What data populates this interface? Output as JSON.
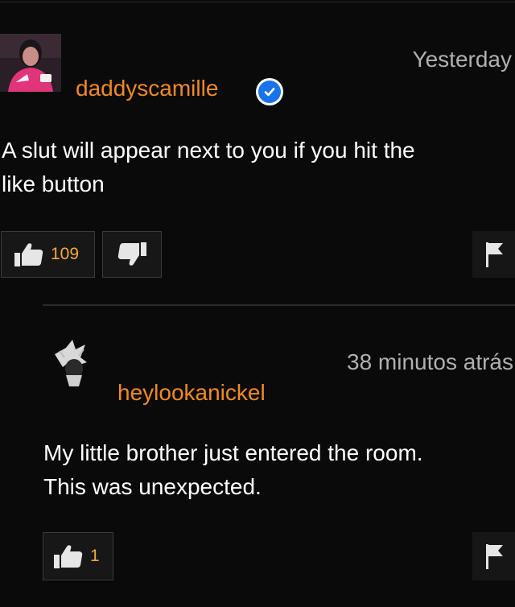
{
  "comments": [
    {
      "username": "daddyscamille",
      "verified": true,
      "verified_icon": "verified-check-icon",
      "timestamp": "Yesterday",
      "text_lines": [
        "A slut will appear next to you if you hit the",
        "like button"
      ],
      "likes": "109",
      "has_dislike": true
    },
    {
      "username": "heylookanickel",
      "verified": false,
      "timestamp": "38 minutos atrás",
      "text_lines": [
        "My little brother just entered the room.",
        "This was unexpected."
      ],
      "likes": "1",
      "has_dislike": false
    }
  ],
  "icons": {
    "like": "thumbs-up-icon",
    "dislike": "thumbs-down-icon",
    "flag": "flag-icon"
  },
  "colors": {
    "background": "#0a0a0a",
    "username": "#f08a24",
    "count": "#f2a93b",
    "timestamp": "#b0b0b0",
    "verified": "#1a73e8"
  }
}
